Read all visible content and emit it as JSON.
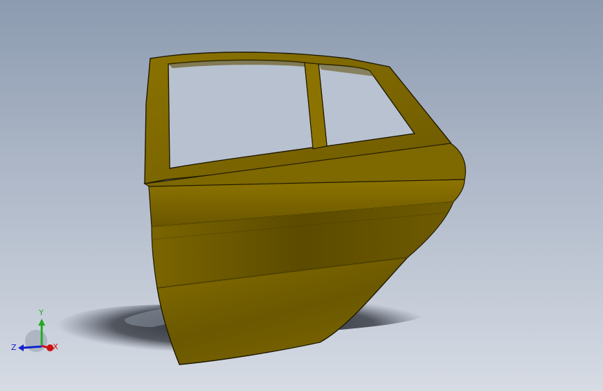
{
  "viewport": {
    "background_top": "#8c9bb0",
    "background_bottom": "#d6dbe4"
  },
  "model": {
    "part_name": "car-rear-door",
    "body_color": "#7a6300",
    "body_color_light": "#9c8000",
    "body_color_dark": "#574500",
    "edge_color": "#1f1a00"
  },
  "triad": {
    "x_label": "X",
    "y_label": "Y",
    "z_label": "Z",
    "x_color": "#cc1111",
    "y_color": "#22aa22",
    "z_color": "#1122cc"
  }
}
